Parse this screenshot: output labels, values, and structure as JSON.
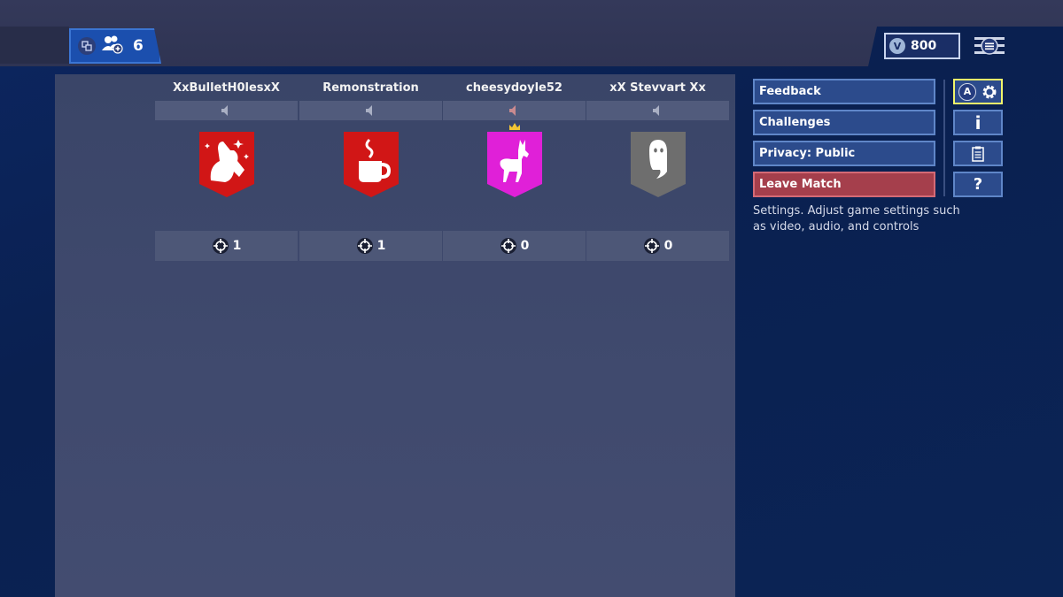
{
  "topbar": {
    "party_count": "6",
    "vbucks": {
      "coin_letter": "V",
      "amount": "800"
    }
  },
  "players": [
    {
      "name": "XxBulletH0lesxX",
      "banner": "llama-sparkle",
      "banner_color": "#d11616",
      "kills": "1",
      "crown": false,
      "muted_color": "#a9afc3"
    },
    {
      "name": "Remonstration",
      "banner": "coffee-mug",
      "banner_color": "#d11616",
      "kills": "1",
      "crown": false,
      "muted_color": "#a9afc3"
    },
    {
      "name": "cheesydoyle52",
      "banner": "llama",
      "banner_color": "#e020d8",
      "kills": "0",
      "crown": true,
      "muted_color": "#c98a8f"
    },
    {
      "name": "xX Stevvart Xx",
      "banner": "ghost",
      "banner_color": "#6e6e6e",
      "kills": "0",
      "crown": false,
      "muted_color": "#a9afc3"
    }
  ],
  "menu": {
    "items": [
      {
        "label": "Feedback"
      },
      {
        "label": "Challenges"
      },
      {
        "label": "Privacy: Public"
      },
      {
        "label": "Leave Match"
      }
    ],
    "side_buttons": [
      {
        "icon": "settings-gear-icon",
        "badge": "A",
        "selected": true
      },
      {
        "icon": "info-icon",
        "glyph": "i"
      },
      {
        "icon": "clipboard-icon"
      },
      {
        "icon": "help-icon",
        "glyph": "?"
      }
    ],
    "tooltip": "Settings. Adjust game settings such as video, audio, and controls"
  },
  "colors": {
    "accent_border": "#5f86c8",
    "button_fill": "#2c4b8c",
    "danger_fill": "#a53f4c",
    "selected_border": "#f1f56a"
  }
}
